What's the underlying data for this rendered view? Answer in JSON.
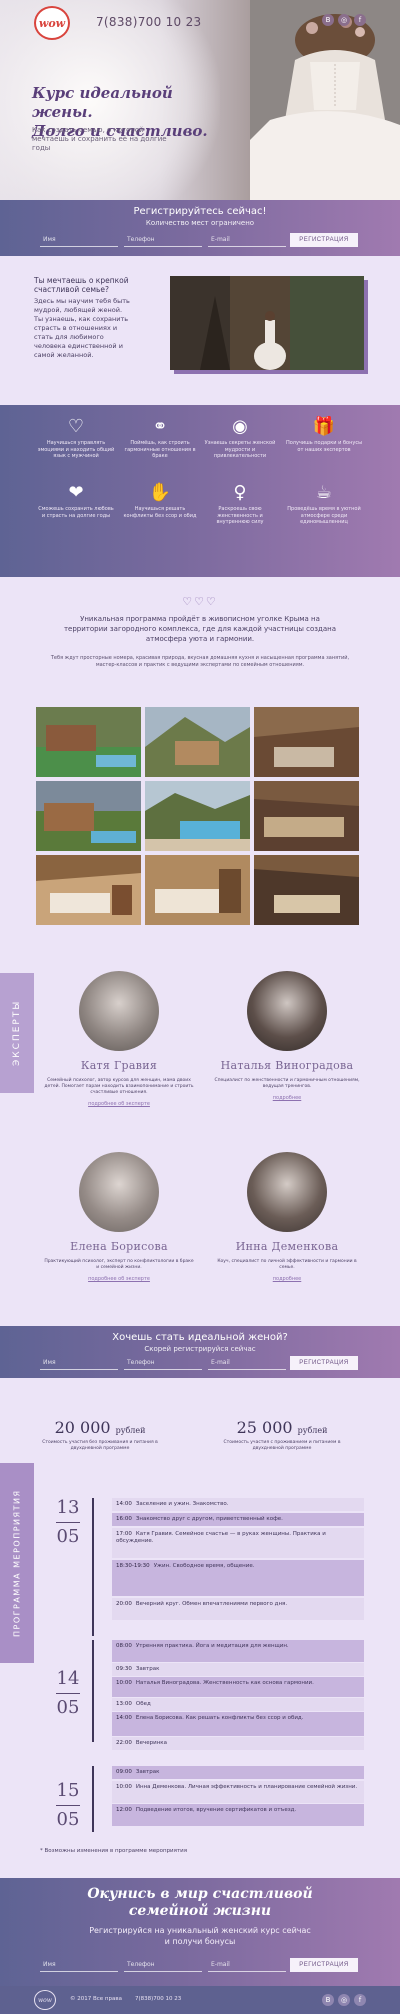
{
  "hero": {
    "logo": "wow",
    "phone": "7(838)700 10 23",
    "title_line1": "Курс идеальной жены.",
    "title_line2": "Долго и счастливо.",
    "subtitle": "Как создать семью, о которой мечтаешь и сохранить её на долгие годы"
  },
  "socials": [
    "vk",
    "instagram",
    "facebook"
  ],
  "form_top": {
    "title": "Регистрируйтесь сейчас!",
    "subtitle": "Количество мест ограничено",
    "name_placeholder": "Имя",
    "phone_placeholder": "Телефон",
    "email_placeholder": "E-mail",
    "button": "РЕГИСТРАЦИЯ"
  },
  "intro": {
    "heading": "Ты мечтаешь о крепкой счастливой семье?",
    "text": "Здесь мы научим тебя быть мудрой, любящей женой. Ты узнаешь, как сохранить страсть в отношениях и стать для любимого человека единственной и самой желанной."
  },
  "features": [
    {
      "icon": "heart-outline-icon",
      "glyph": "♡",
      "text": "Научишься управлять эмоциями и находить общий язык с мужчиной"
    },
    {
      "icon": "rings-icon",
      "glyph": "⚭",
      "text": "Поймёшь, как строить гармоничные отношения в браке"
    },
    {
      "icon": "eye-icon",
      "glyph": "◉",
      "text": "Узнаешь секреты женской мудрости и привлекательности"
    },
    {
      "icon": "gift-icon",
      "glyph": "🎁",
      "text": "Получишь подарки и бонусы от наших экспертов"
    },
    {
      "icon": "hand-heart-icon",
      "glyph": "❤",
      "text": "Сможешь сохранить любовь и страсть на долгие годы"
    },
    {
      "icon": "handshake-icon",
      "glyph": "✋",
      "text": "Научишься решать конфликты без ссор и обид"
    },
    {
      "icon": "woman-icon",
      "glyph": "♀",
      "text": "Раскроешь свою женственность и внутреннюю силу"
    },
    {
      "icon": "coffee-icon",
      "glyph": "☕",
      "text": "Проведёшь время в уютной атмосфере среди единомышленниц"
    }
  ],
  "about": {
    "hearts": "♡♡♡",
    "text1": "Уникальная программа пройдёт в живописном уголке Крыма на территории загородного комплекса, где для каждой участницы создана атмосфера уюта и гармонии.",
    "text2": "Тебя ждут просторные номера, красивая природа, вкусная домашняя кухня и насыщенная программа занятий, мастер-классов и практик с ведущими экспертами по семейным отношениям."
  },
  "experts_tab": "ЭКСПЕРТЫ",
  "experts": [
    {
      "name": "Катя Гравия",
      "desc": "Семейный психолог, автор курсов для женщин, мама двоих детей. Помогает парам находить взаимопонимание и строить счастливые отношения.",
      "link": "подробнее об эксперте"
    },
    {
      "name": "Наталья Виноградова",
      "desc": "Специалист по женственности и гармоничным отношениям, ведущая тренингов.",
      "link": "подробнее"
    },
    {
      "name": "Елена Борисова",
      "desc": "Практикующий психолог, эксперт по конфликтологии в браке и семейной жизни.",
      "link": "подробнее об эксперте"
    },
    {
      "name": "Инна Деменкова",
      "desc": "Коуч, специалист по личной эффективности и гармонии в семье.",
      "link": "подробнее"
    }
  ],
  "form_mid": {
    "title": "Хочешь стать идеальной женой?",
    "subtitle": "Скорей регистрируйся сейчас",
    "name_placeholder": "Имя",
    "phone_placeholder": "Телефон",
    "email_placeholder": "E-mail",
    "button": "РЕГИСТРАЦИЯ"
  },
  "prices": [
    {
      "amount": "20 000",
      "unit": "рублей",
      "note": "Стоимость участия без проживания и питания в двухдневной программе"
    },
    {
      "amount": "25 000",
      "unit": "рублей",
      "note": "Стоимость участия с проживанием и питанием в двухдневной программе"
    }
  ],
  "program_tab": "ПРОГРАММА МЕРОПРИЯТИЯ",
  "program": [
    {
      "day": "13",
      "month": "05",
      "rows": [
        {
          "time": "14:00",
          "text": "Заселение и ужин. Знакомство."
        },
        {
          "time": "16:00",
          "text": "Знакомство друг с другом, приветственный кофе."
        },
        {
          "time": "17:00",
          "text": "Катя Гравия. Семейное счастье — в руках женщины. Практика и обсуждение."
        },
        {
          "time": "18:30-19:30",
          "text": "Ужин. Свободное время, общение."
        },
        {
          "time": "20:00",
          "text": "Вечерний круг. Обмен впечатлениями первого дня."
        }
      ]
    },
    {
      "day": "14",
      "month": "05",
      "rows": [
        {
          "time": "08:00",
          "text": "Утренняя практика. Йога и медитация для женщин."
        },
        {
          "time": "09:30",
          "text": "Завтрак"
        },
        {
          "time": "10:00",
          "text": "Наталья Виноградова. Женственность как основа гармонии."
        },
        {
          "time": "13:00",
          "text": "Обед"
        },
        {
          "time": "14:00",
          "text": "Елена Борисова. Как решать конфликты без ссор и обид."
        },
        {
          "time": "22:00",
          "text": "Вечеринка"
        }
      ]
    },
    {
      "day": "15",
      "month": "05",
      "rows": [
        {
          "time": "09:00",
          "text": "Завтрак"
        },
        {
          "time": "10:00",
          "text": "Инна Деменкова. Личная эффективность и планирование семейной жизни."
        },
        {
          "time": "12:00",
          "text": "Подведение итогов, вручение сертификатов и отъезд."
        }
      ]
    }
  ],
  "program_footnote": "* Возможны изменения в программе мероприятия",
  "final": {
    "title_line1": "Окунись в мир счастливой",
    "title_line2": "семейной жизни",
    "text_line1": "Регистрируйся на уникальный женский курс сейчас",
    "text_line2": "и получи бонусы",
    "name_placeholder": "Имя",
    "phone_placeholder": "Телефон",
    "email_placeholder": "E-mail",
    "button": "РЕГИСТРАЦИЯ"
  },
  "footer": {
    "logo": "wow",
    "copyright": "© 2017 Все права",
    "phone": "7(838)700 10 23"
  },
  "colors": {
    "accent": "#8d71b0",
    "gradient_start": "#5e6394",
    "gradient_end": "#a07ab0",
    "logo_red": "#d9443d"
  }
}
